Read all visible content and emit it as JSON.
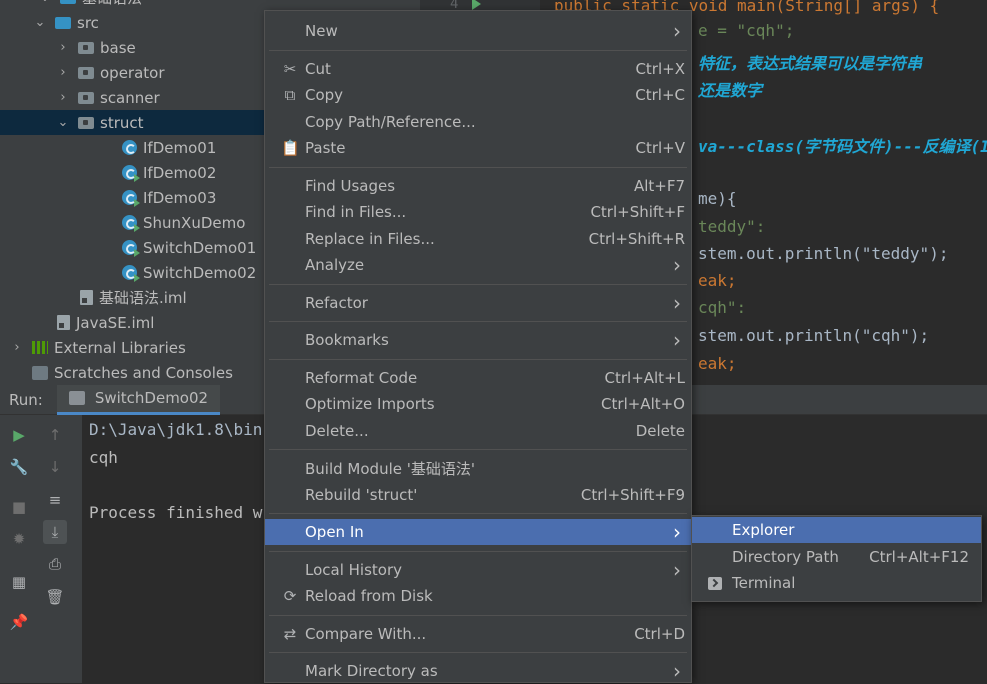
{
  "project": {
    "rows": [
      {
        "label": "基础语法",
        "y": -6,
        "indent": 60,
        "kind": "folder-blue",
        "arrow": "⌄"
      },
      {
        "label": "src",
        "indent": 55,
        "kind": "folder-blue",
        "arrow": "⌄"
      },
      {
        "label": "base",
        "indent": 78,
        "kind": "folder",
        "arrow": "›"
      },
      {
        "label": "operator",
        "indent": 78,
        "kind": "folder",
        "arrow": "›"
      },
      {
        "label": "scanner",
        "indent": 78,
        "kind": "folder",
        "arrow": "›"
      },
      {
        "label": "struct",
        "indent": 78,
        "kind": "folder",
        "arrow": "⌄",
        "selected": true
      },
      {
        "label": "IfDemo01",
        "indent": 122,
        "kind": "class"
      },
      {
        "label": "IfDemo02",
        "indent": 122,
        "kind": "class-run"
      },
      {
        "label": "IfDemo03",
        "indent": 122,
        "kind": "class-run"
      },
      {
        "label": "ShunXuDemo",
        "indent": 122,
        "kind": "class-run"
      },
      {
        "label": "SwitchDemo01",
        "indent": 122,
        "kind": "class-run"
      },
      {
        "label": "SwitchDemo02",
        "indent": 122,
        "kind": "class-run"
      },
      {
        "label": "基础语法.iml",
        "indent": 80,
        "kind": "file"
      },
      {
        "label": "JavaSE.iml",
        "indent": 57,
        "kind": "file"
      },
      {
        "label": "External Libraries",
        "indent": 10,
        "kind": "lib",
        "arrow": "›"
      },
      {
        "label": "Scratches and Consoles",
        "indent": 32,
        "kind": "scratch"
      }
    ]
  },
  "editor": {
    "line_number": "4",
    "lines": [
      {
        "text": "public static void main(String[] args) {",
        "color": "#cc7832"
      },
      {
        "text": "e = \"cqh\";",
        "color": "#6a8759"
      },
      {
        "text": "特征，表达式结果可以是字符串",
        "color": "#629755"
      },
      {
        "text": "还是数字",
        "color": "#629755"
      },
      {
        "text": "va---class(字节码文件)---反编译(I",
        "color": "#629755"
      },
      {
        "text": "me){",
        "color": "#a9b7c6"
      },
      {
        "text": "teddy\":",
        "color": "#6a8759"
      },
      {
        "text": "stem.out.println(\"teddy\");",
        "color": "#a9b7c6"
      },
      {
        "text": "eak;",
        "color": "#cc7832"
      },
      {
        "text": "cqh\":",
        "color": "#6a8759"
      },
      {
        "text": "stem.out.println(\"cqh\");",
        "color": "#a9b7c6"
      },
      {
        "text": "eak;",
        "color": "#cc7832"
      }
    ]
  },
  "run": {
    "label": "Run:",
    "tab": "SwitchDemo02",
    "console": [
      "D:\\Java\\jdk1.8\\bin",
      "cqh",
      "",
      "Process finished w"
    ]
  },
  "menu": {
    "items": [
      {
        "label": "New",
        "icon": "",
        "shortcut": "",
        "submenu": true
      },
      {
        "sep": true
      },
      {
        "label": "Cut",
        "icon": "scissors-icon",
        "shortcut": "Ctrl+X"
      },
      {
        "label": "Copy",
        "icon": "copy-icon",
        "shortcut": "Ctrl+C"
      },
      {
        "label": "Copy Path/Reference...",
        "icon": "",
        "shortcut": ""
      },
      {
        "label": "Paste",
        "icon": "clipboard-icon",
        "shortcut": "Ctrl+V"
      },
      {
        "sep": true
      },
      {
        "label": "Find Usages",
        "icon": "",
        "shortcut": "Alt+F7"
      },
      {
        "label": "Find in Files...",
        "icon": "",
        "shortcut": "Ctrl+Shift+F"
      },
      {
        "label": "Replace in Files...",
        "icon": "",
        "shortcut": "Ctrl+Shift+R"
      },
      {
        "label": "Analyze",
        "icon": "",
        "shortcut": "",
        "submenu": true
      },
      {
        "sep": true
      },
      {
        "label": "Refactor",
        "icon": "",
        "shortcut": "",
        "submenu": true
      },
      {
        "sep": true
      },
      {
        "label": "Bookmarks",
        "icon": "",
        "shortcut": "",
        "submenu": true
      },
      {
        "sep": true
      },
      {
        "label": "Reformat Code",
        "icon": "",
        "shortcut": "Ctrl+Alt+L"
      },
      {
        "label": "Optimize Imports",
        "icon": "",
        "shortcut": "Ctrl+Alt+O"
      },
      {
        "label": "Delete...",
        "icon": "",
        "shortcut": "Delete"
      },
      {
        "sep": true
      },
      {
        "label": "Build Module '基础语法'",
        "icon": "",
        "shortcut": ""
      },
      {
        "label": "Rebuild 'struct'",
        "icon": "",
        "shortcut": "Ctrl+Shift+F9"
      },
      {
        "sep": true
      },
      {
        "label": "Open In",
        "icon": "",
        "shortcut": "",
        "submenu": true,
        "active": true
      },
      {
        "sep": true
      },
      {
        "label": "Local History",
        "icon": "",
        "shortcut": "",
        "submenu": true
      },
      {
        "label": "Reload from Disk",
        "icon": "reload-icon",
        "shortcut": ""
      },
      {
        "sep": true
      },
      {
        "label": "Compare With...",
        "icon": "compare-icon",
        "shortcut": "Ctrl+D"
      },
      {
        "sep": true
      },
      {
        "label": "Mark Directory as",
        "icon": "",
        "shortcut": "",
        "submenu": true
      }
    ]
  },
  "submenu": {
    "items": [
      {
        "label": "Explorer",
        "shortcut": "",
        "active": true
      },
      {
        "label": "Directory Path",
        "shortcut": "Ctrl+Alt+F12"
      },
      {
        "label": "Terminal",
        "shortcut": "",
        "icon": "terminal-icon"
      }
    ]
  },
  "colors": {
    "menu_bg": "#3c3f41",
    "selection": "#4b6eaf",
    "panel": "#3c3f41",
    "editor_bg": "#2b2b2b"
  }
}
